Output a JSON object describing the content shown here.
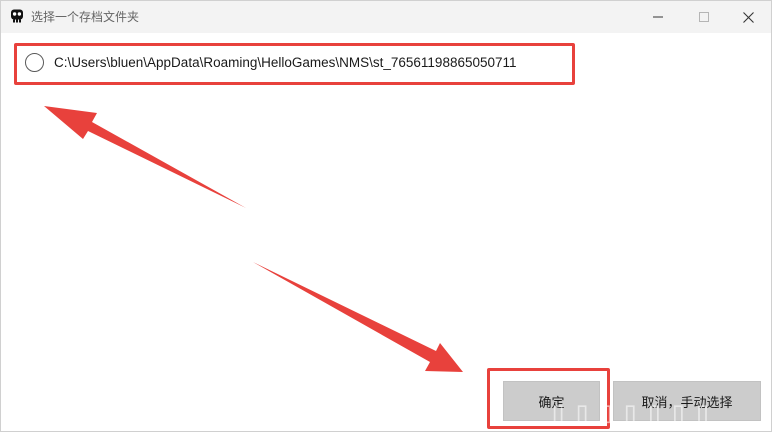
{
  "window": {
    "title": "选择一个存档文件夹",
    "app_icon": "skull-icon",
    "controls": [
      "minimize-icon",
      "maximize-icon",
      "close-icon"
    ]
  },
  "options": [
    {
      "label": "C:\\Users\\bluen\\AppData\\Roaming\\HelloGames\\NMS\\st_76561198865050711",
      "selected": false
    }
  ],
  "buttons": {
    "confirm_label": "确定",
    "cancel_label": "取消，手动选择"
  },
  "annotations": {
    "highlight_color": "#e8413c"
  }
}
